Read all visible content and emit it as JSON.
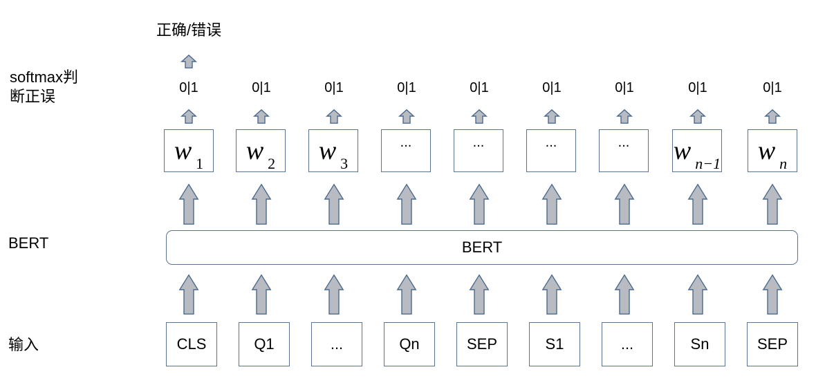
{
  "side_labels": {
    "softmax": "softmax判\n断正误",
    "bert": "BERT",
    "input": "输入"
  },
  "output_label": "正确/错误",
  "bert_label": "BERT",
  "prob_labels": [
    "0|1",
    "0|1",
    "0|1",
    "0|1",
    "0|1",
    "0|1",
    "0|1",
    "0|1",
    "0|1"
  ],
  "w_boxes": [
    {
      "type": "w",
      "main": "w",
      "sub": "1"
    },
    {
      "type": "w",
      "main": "w",
      "sub": "2"
    },
    {
      "type": "w",
      "main": "w",
      "sub": "3"
    },
    {
      "type": "dots",
      "text": "..."
    },
    {
      "type": "dots",
      "text": "..."
    },
    {
      "type": "dots",
      "text": "..."
    },
    {
      "type": "dots",
      "text": "..."
    },
    {
      "type": "w",
      "main": "w",
      "sub": "n−1",
      "sub_italic": true
    },
    {
      "type": "w",
      "main": "w",
      "sub": "n",
      "sub_italic": true
    }
  ],
  "inputs": [
    "CLS",
    "Q1",
    "...",
    "Qn",
    "SEP",
    "S1",
    "...",
    "Sn",
    "SEP"
  ],
  "colors": {
    "arrow_fill": "#b8bcc2",
    "arrow_stroke": "#4a6a8e",
    "box_border": "#5a7391"
  }
}
